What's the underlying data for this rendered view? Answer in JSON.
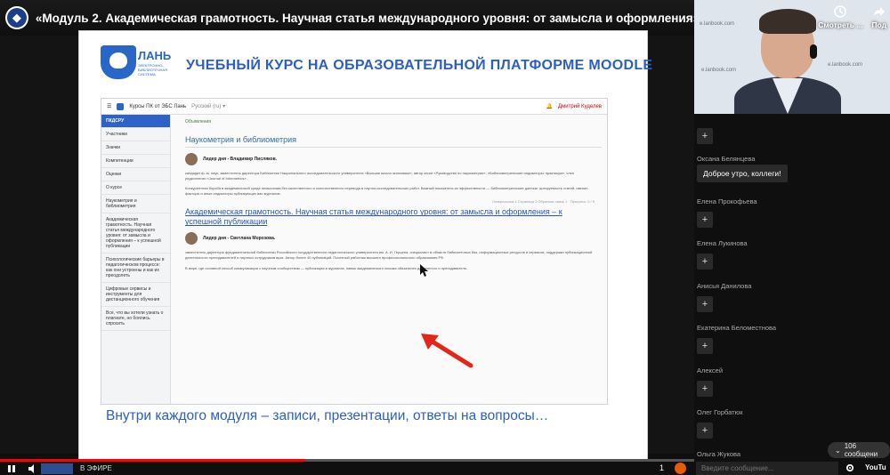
{
  "header": {
    "title": "«Модуль 2. Академическая грамотность. Научная статья международного уровня: от замысла и оформления»"
  },
  "slide": {
    "brand": "ЛАНЬ",
    "brand_sub": "ЭЛЕКТРОННО-БИБЛИОТЕЧНАЯ СИСТЕМА",
    "heading": "УЧЕБНЫЙ КУРС НА ОБРАЗОВАТЕЛЬНОЙ ПЛАТФОРМЕ MOODLE",
    "footer": "Внутри каждого модуля – записи, презентации, ответы на вопросы…",
    "moodle": {
      "nav_title": "Курсы ПК от ЭБС Лань",
      "nav_lang": "Русский (ru) ▾",
      "nav_user": "Дмитрий Куделев",
      "sidebar": [
        "ПКДСРУ",
        "Участники",
        "Значки",
        "Компетенции",
        "Оценки",
        "О курсе",
        "Наукометрия и библиометрия",
        "Академическая грамотность. Научная статья международного уровня: от замысла и оформления – к успешной публикации",
        "Психологические барьеры в педагогическом процессе: как они устроены и как их преодолеть",
        "Цифровые сервисы и инструменты для дистанционного обучения",
        "Все, что вы хотели узнать о плагиате, но боялись спросить"
      ],
      "announcement": "Объявления",
      "section1_title": "Наукометрия и библиометрия",
      "leader1": "Лидер дня - Владимир Писляков.",
      "text1": "кандидат ф.-м. наук, заместитель директора Библиотеки Национального исследовательского университета «Высшая школа экономики», автор книги «Руководство по наукометрии», «Библиометрические индикаторы: практикум», член редколлегии «Journal of Informetrics».",
      "text2": "Конкурентная борьба в академической среде немыслима без качественного и количественного перевода в научно-исследовательских работ. Важный показатель их эффективности — библиометрические данные: цитируемость статей, импакт-факторы и иные индикаторы публикующих вас журналов.",
      "meta": "Гиперссылка 1 Страница 1 Обратная связь 1 · Прогресс: 0 / 9",
      "section2_link": "Академическая грамотность. Научная статья международного уровня: от замысла и оформления – к успешной публикации",
      "leader2": "Лидер дня - Светлана Морозова.",
      "text3": "заместитель директора фундаментальной библиотеки Российского государственного педагогического университета им. А. И. Герцена, специалист в области библиотечных баз, информационных ресурсов и сервисов, поддержки публикационной деятельности преподавателей и научных сотрудников вуза. Автор более 40 публикаций. Почетный работник высшего профессионального образования РФ.",
      "text4": "В мире, где основной способ коммуникации с научным сообществом — публикация в журналах, навык академического письма обязателен для ученого и преподавателя."
    }
  },
  "webcam": {
    "watch_label": "Смотреть ...",
    "share_label": "Под",
    "bg_text": "e.lanbook.com"
  },
  "chat": {
    "messages": [
      {
        "author": "Оксана Белянцева",
        "text": "Доброе утро, коллеги!"
      },
      {
        "author": "Елена Прокофьева",
        "text": ""
      },
      {
        "author": "Елена Лукинова",
        "text": ""
      },
      {
        "author": "Анисья Данилова",
        "text": ""
      },
      {
        "author": "Екатерина Беломестнова",
        "text": ""
      },
      {
        "author": "Алексей",
        "text": ""
      },
      {
        "author": "Олег Горбатюк",
        "text": ""
      },
      {
        "author": "Ольга Жукова",
        "text": ""
      }
    ],
    "plus_label": "+",
    "count_label": "106 сообщени"
  },
  "player": {
    "live_label": "В ЭФИРЕ",
    "viewers": "1",
    "chat_placeholder": "Введите сообщение...",
    "yt_label": "YouTu",
    "progress": 0.44
  }
}
